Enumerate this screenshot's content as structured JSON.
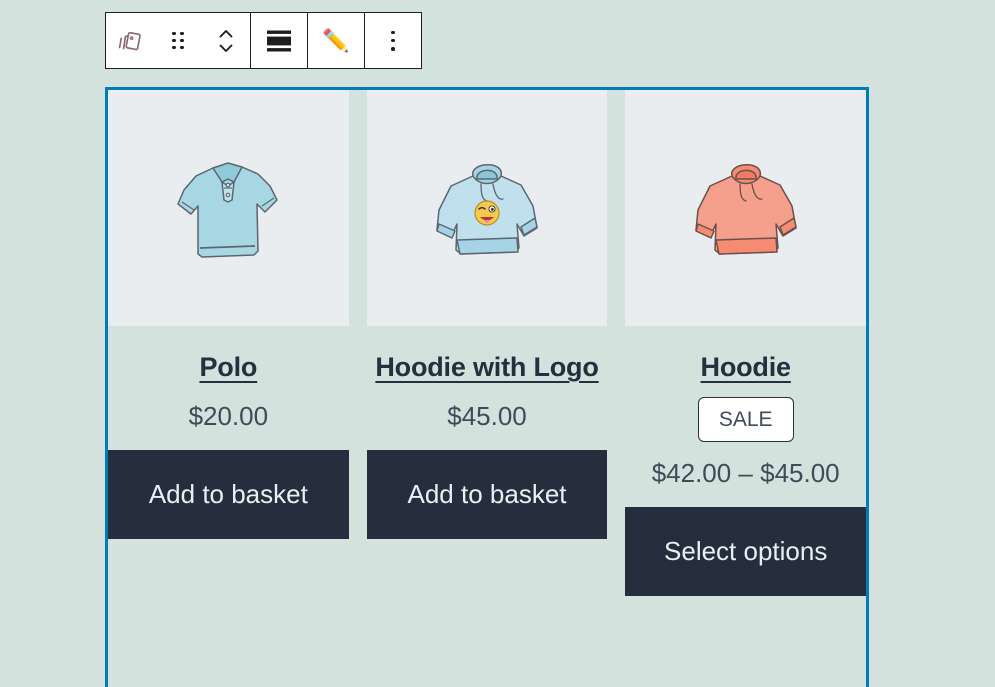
{
  "colors": {
    "canvas_background": "#d3e2dc",
    "selection_border": "#007cba",
    "toolbar_border": "#1e1e1e",
    "toolbar_background": "#ffffff",
    "image_background": "#e9edf0",
    "button_background": "#262e3d",
    "button_text": "#e7f0f3",
    "title_text": "#22303f",
    "price_text": "#3f4b58",
    "block_icon": "#8f6b72",
    "polo_blue": "#a8d7e4",
    "hoodie_blue": "#bfe0ec",
    "hoodie_coral": "#f4a08c"
  },
  "toolbar": {
    "block_type_label": "Product Collection",
    "items": [
      {
        "name": "product-collection-icon",
        "label": "Product Collection"
      },
      {
        "name": "drag-handle-icon",
        "label": "Drag"
      },
      {
        "name": "move-up-down-icon",
        "label": "Move up or down"
      },
      {
        "name": "align-icon",
        "label": "Align"
      },
      {
        "name": "edit-pencil-icon",
        "label": "Edit",
        "glyph": "✏️"
      },
      {
        "name": "more-options-icon",
        "label": "Options"
      }
    ]
  },
  "products": [
    {
      "title": "Polo",
      "price": "$20.00",
      "badge": null,
      "button_label": "Add to basket",
      "image_name": "polo-shirt-image",
      "image_alt": "Light blue polo shirt"
    },
    {
      "title": "Hoodie with Logo",
      "price": "$45.00",
      "badge": null,
      "button_label": "Add to basket",
      "image_name": "hoodie-with-logo-image",
      "image_alt": "Light blue hoodie with emoji logo"
    },
    {
      "title": "Hoodie",
      "price": "$42.00 – $45.00",
      "badge": "SALE",
      "button_label": "Select options",
      "image_name": "hoodie-image",
      "image_alt": "Coral hoodie"
    }
  ]
}
